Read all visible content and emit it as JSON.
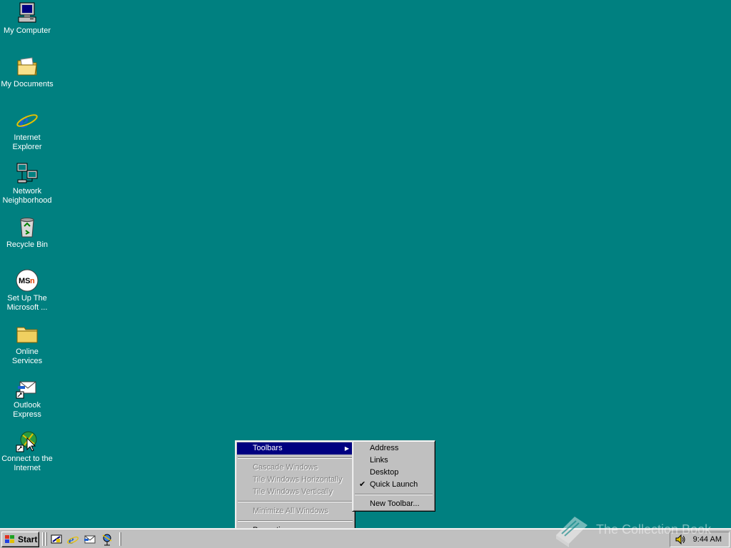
{
  "desktop": {
    "icons": [
      {
        "label_1": "My Computer",
        "label_2": ""
      },
      {
        "label_1": "My Documents",
        "label_2": ""
      },
      {
        "label_1": "Internet",
        "label_2": "Explorer"
      },
      {
        "label_1": "Network",
        "label_2": "Neighborhood"
      },
      {
        "label_1": "Recycle Bin",
        "label_2": ""
      },
      {
        "label_1": "Set Up The",
        "label_2": "Microsoft ..."
      },
      {
        "label_1": "Online",
        "label_2": "Services"
      },
      {
        "label_1": "Outlook",
        "label_2": "Express"
      },
      {
        "label_1": "Connect to the",
        "label_2": "Internet"
      }
    ],
    "background_color": "#008080"
  },
  "context_menu": {
    "toolbars": "Toolbars",
    "cascade": "Cascade Windows",
    "tile_h": "Tile Windows Horizontally",
    "tile_v": "Tile Windows Vertically",
    "minimize_all": "Minimize All Windows",
    "properties": "Properties"
  },
  "toolbars_submenu": {
    "address": "Address",
    "links": "Links",
    "desktop": "Desktop",
    "quick_launch": "Quick Launch",
    "quick_launch_checked": true,
    "new_toolbar": "New Toolbar..."
  },
  "taskbar": {
    "start_label": "Start",
    "clock": "9:44 AM",
    "quick_launch_icons": [
      "show-desktop-icon",
      "internet-explorer-icon",
      "outlook-express-icon",
      "channels-icon"
    ]
  },
  "watermark": {
    "text": "The Collection Book"
  },
  "colors": {
    "menu_highlight": "#000080",
    "menu_face": "#c0c0c0"
  }
}
